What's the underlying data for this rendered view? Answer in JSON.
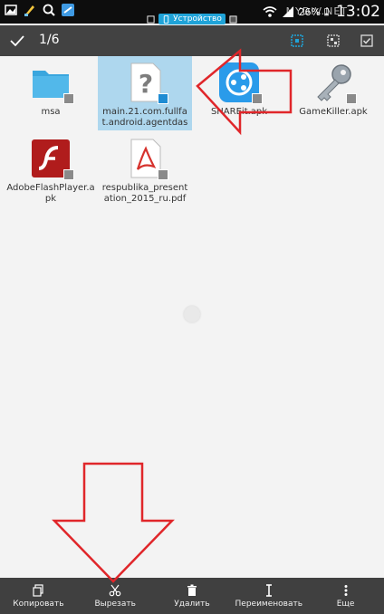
{
  "status": {
    "battery": "26%",
    "time": "13:02",
    "watermark": "MYDIV.NET"
  },
  "location": {
    "label": "Устройство"
  },
  "actionbar": {
    "selection_count": "1/6"
  },
  "files": [
    {
      "name": "msa",
      "type": "folder"
    },
    {
      "name": "main.21.com.fullfat.android.agentdas",
      "type": "unknown",
      "selected": true
    },
    {
      "name": "SHAREit.apk",
      "type": "apk-shareit"
    },
    {
      "name": "GameKiller.apk",
      "type": "apk-gamekiller"
    },
    {
      "name": "AdobeFlashPlayer.apk",
      "type": "apk-flash"
    },
    {
      "name": "respublika_presentation_2015_ru.pdf",
      "type": "pdf"
    }
  ],
  "bottombar": {
    "copy": "Копировать",
    "cut": "Вырезать",
    "delete": "Удалить",
    "rename": "Переименовать",
    "more": "Еще"
  },
  "colors": {
    "accent": "#1fa3d8",
    "annotation": "#e0262a",
    "selection": "#aed7ee"
  }
}
